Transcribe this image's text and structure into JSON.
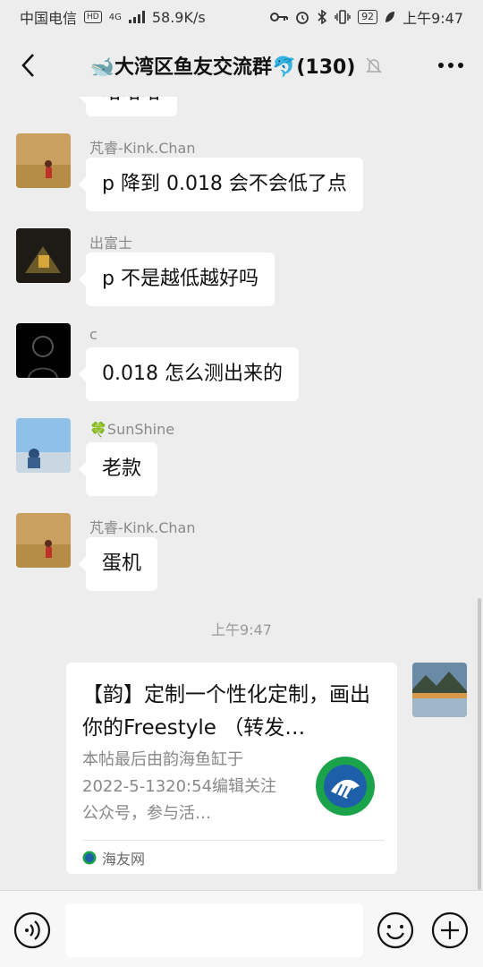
{
  "status_bar": {
    "carrier": "中国电信",
    "hd": "HD",
    "network": "4G",
    "speed": "58.9K/s",
    "battery": "92",
    "time": "上午9:47"
  },
  "header": {
    "title": "🐋大湾区鱼友交流群🐬(130)"
  },
  "messages": [
    {
      "sender": "",
      "text": "哈哈哈"
    },
    {
      "sender": "芃睿-Kink.Chan",
      "text": "p 降到 0.018 会不会低了点"
    },
    {
      "sender": "出富士",
      "text": "p 不是越低越好吗"
    },
    {
      "sender": "c",
      "text": "0.018 怎么测出来的"
    },
    {
      "sender": "🍀SunShine",
      "text": "老款"
    },
    {
      "sender": "芃睿-Kink.Chan",
      "text": "蛋机"
    }
  ],
  "timestamp": "上午9:47",
  "link_card": {
    "title": "【韵】定制一个性化定制，画出你的Freestyle （转发…",
    "description": "本帖最后由韵海鱼缸于2022-5-1320:54编辑关注公众号，参与活…",
    "source": "海友网"
  },
  "input": {
    "placeholder": ""
  },
  "colors": {
    "background": "#ededed",
    "bubble": "#ffffff",
    "sender_text": "#8a8a8a",
    "accent_logo": "#1aa34a"
  }
}
